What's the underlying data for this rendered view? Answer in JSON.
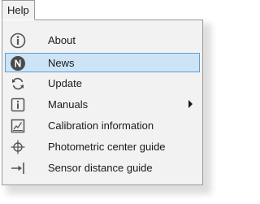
{
  "menubar": {
    "help_label": "Help"
  },
  "menu": {
    "items": [
      {
        "label": "About",
        "icon": "info-circle-icon"
      },
      {
        "label": "News",
        "icon": "news-n-icon",
        "highlighted": true
      },
      {
        "label": "Update",
        "icon": "refresh-icon"
      },
      {
        "label": "Manuals",
        "icon": "info-book-icon",
        "has_submenu": true
      },
      {
        "label": "Calibration information",
        "icon": "calibration-icon"
      },
      {
        "label": "Photometric center guide",
        "icon": "crosshair-icon"
      },
      {
        "label": "Sensor distance guide",
        "icon": "arrow-to-line-icon"
      }
    ]
  },
  "colors": {
    "highlight_bg": "#cde4f7",
    "highlight_border": "#5e9dd4",
    "menu_bg": "#f2f2f2"
  }
}
